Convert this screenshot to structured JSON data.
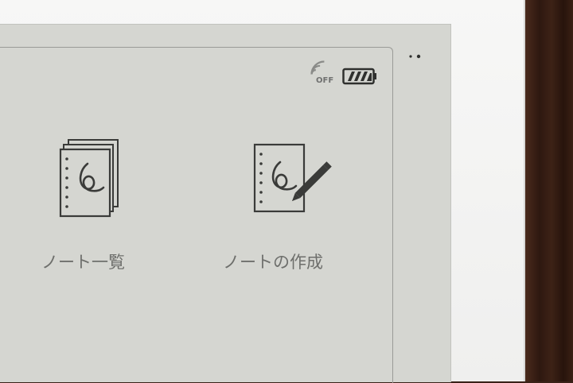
{
  "status": {
    "wifi_icon": "wifi-off-icon",
    "wifi_state": "OFF",
    "battery_icon": "battery-icon",
    "battery_level": 0.8
  },
  "menu": {
    "more_icon": "more-dots-icon"
  },
  "tiles": [
    {
      "label": "ノート一覧",
      "icon": "notebook-stack-icon"
    },
    {
      "label": "ノートの作成",
      "icon": "notebook-pen-icon"
    }
  ],
  "colors": {
    "screen": "#d5d6d1",
    "ink": "#3a3b39",
    "label": "#6e6f6c"
  }
}
